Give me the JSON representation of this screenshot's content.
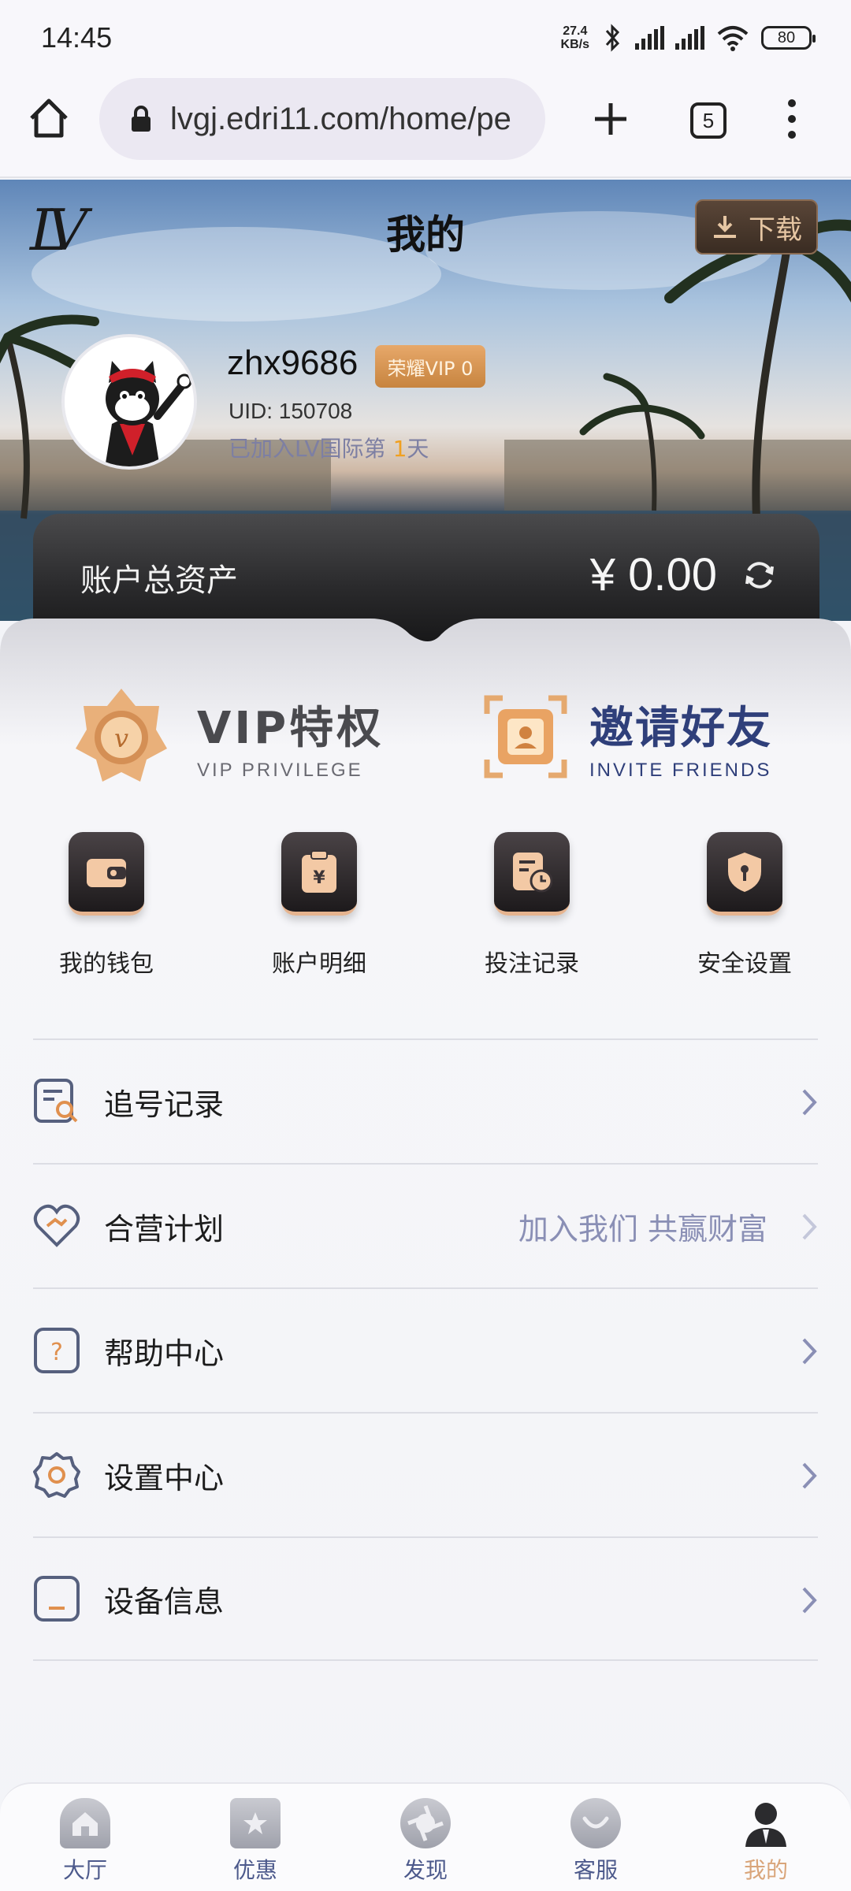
{
  "status_bar": {
    "time": "14:45",
    "net_speed_value": "27.4",
    "net_speed_unit": "KB/s",
    "battery": "80"
  },
  "browser": {
    "url": "lvgj.edri11.com/home/pe",
    "tab_count": "5"
  },
  "header": {
    "title": "我的",
    "download_label": "下载"
  },
  "profile": {
    "username": "zhx9686",
    "vip_badge": "荣耀VIP 0",
    "uid": "UID: 150708",
    "joined_prefix": "已加入LV国际第",
    "joined_days": "1",
    "joined_suffix": "天"
  },
  "assets": {
    "label": "账户总资产",
    "amount": "¥ 0.00"
  },
  "features": [
    {
      "title": "VIP特权",
      "subtitle": "VIP PRIVILEGE"
    },
    {
      "title": "邀请好友",
      "subtitle": "INVITE FRIENDS"
    }
  ],
  "grid": [
    {
      "label": "我的钱包",
      "icon": "wallet-icon"
    },
    {
      "label": "账户明细",
      "icon": "statement-icon"
    },
    {
      "label": "投注记录",
      "icon": "bet-record-icon"
    },
    {
      "label": "安全设置",
      "icon": "security-icon"
    }
  ],
  "menu": [
    {
      "label": "追号记录",
      "extra": "",
      "icon": "search-record-icon"
    },
    {
      "label": "合营计划",
      "extra": "加入我们 共赢财富",
      "icon": "handshake-icon"
    },
    {
      "label": "帮助中心",
      "extra": "",
      "icon": "help-icon"
    },
    {
      "label": "设置中心",
      "extra": "",
      "icon": "gear-icon"
    },
    {
      "label": "设备信息",
      "extra": "",
      "icon": "device-icon"
    }
  ],
  "bottom_nav": [
    {
      "label": "大厅",
      "icon": "home-icon"
    },
    {
      "label": "优惠",
      "icon": "promo-icon"
    },
    {
      "label": "发现",
      "icon": "discover-icon"
    },
    {
      "label": "客服",
      "icon": "support-icon"
    },
    {
      "label": "我的",
      "icon": "profile-icon"
    }
  ],
  "colors": {
    "accent_gold": "#d9a57a",
    "nav_blue": "#4d5a8c",
    "vip_orange": "#c7843f"
  }
}
